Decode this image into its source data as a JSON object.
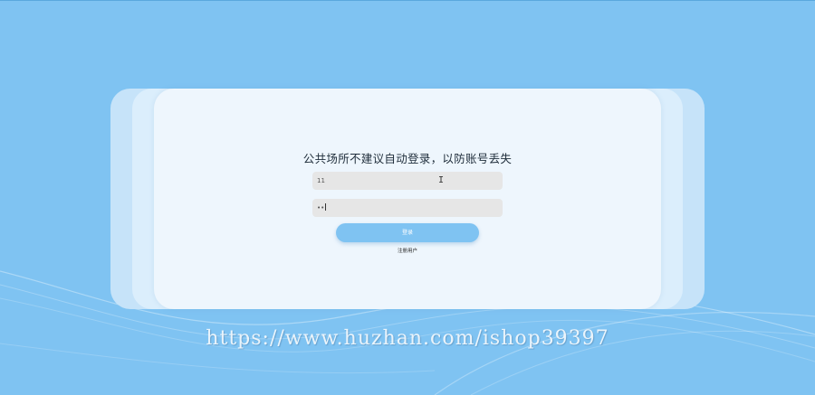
{
  "login": {
    "title": "公共场所不建议自动登录，以防账号丢失",
    "username_value": "11",
    "password_value": "••",
    "login_button": "登录",
    "register_link": "注册用户"
  },
  "watermark": {
    "text": "https://www.huzhan.com/ishop39397"
  },
  "colors": {
    "background": "#7fc3f2",
    "card": "#eef6fd",
    "button": "#7fc3f2",
    "field": "#e6e6e6"
  },
  "icons": {
    "cursor": "text-cursor-icon"
  }
}
